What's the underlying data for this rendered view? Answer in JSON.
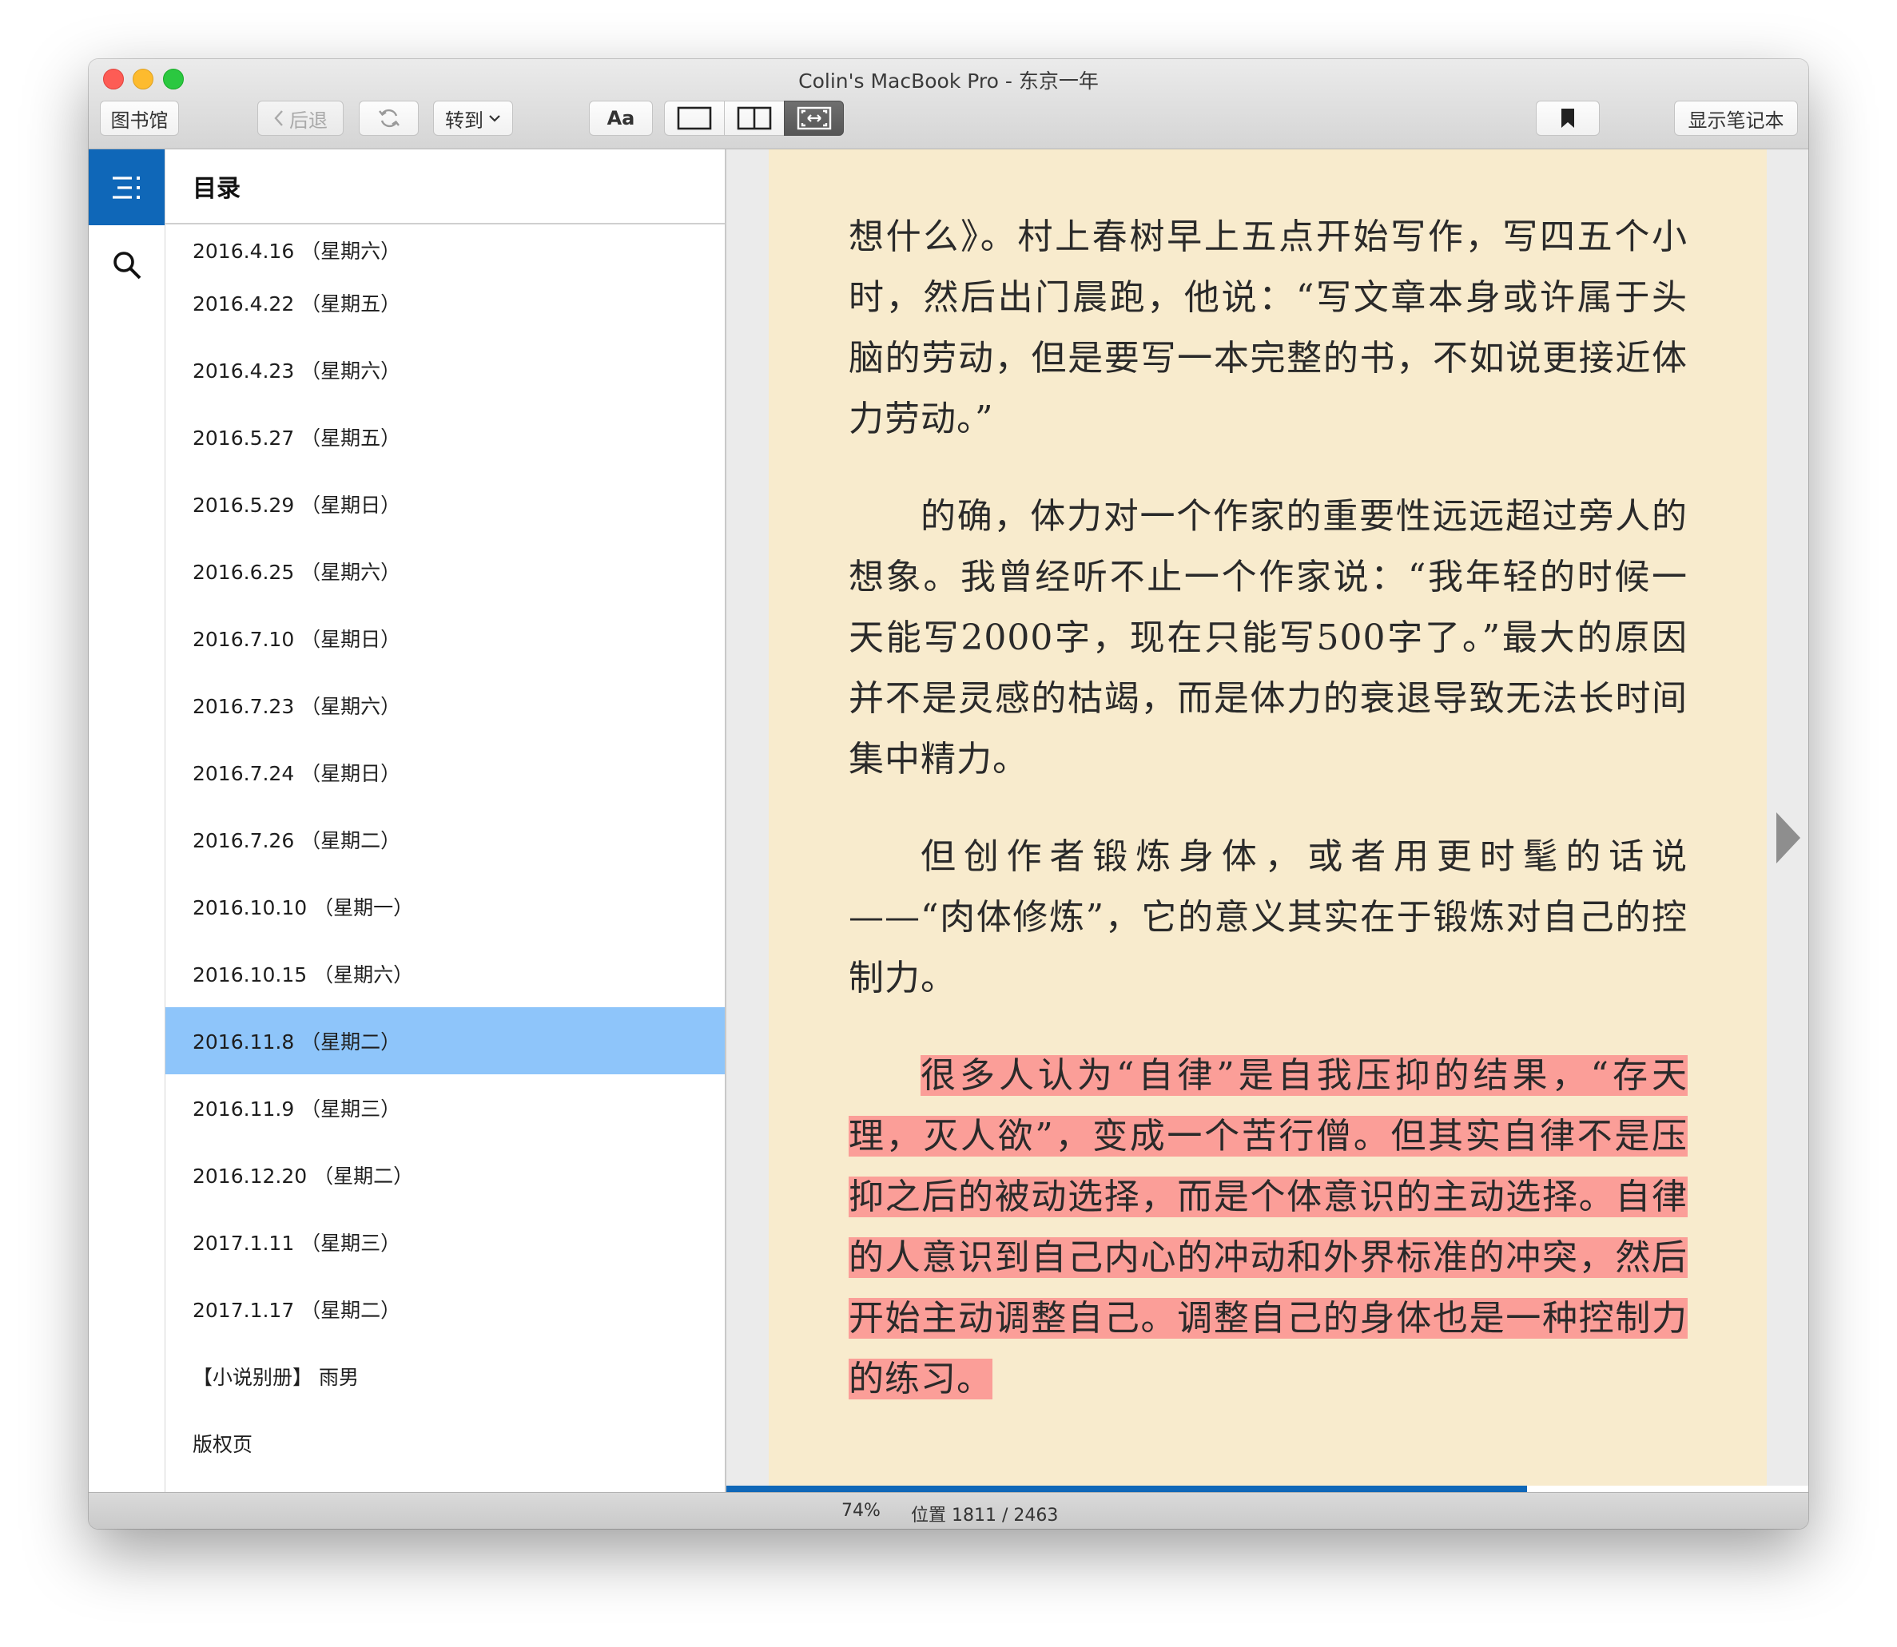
{
  "window": {
    "title": "Colin's MacBook Pro - 东京一年"
  },
  "toolbar": {
    "library_label": "图书馆",
    "back_label": "后退",
    "goto_label": "转到",
    "font_label": "Aa",
    "notebook_label": "显示笔记本",
    "view_modes": [
      "single-page-icon",
      "two-page-icon",
      "fit-width-icon"
    ],
    "active_view_mode": "fit-width-icon"
  },
  "sidebar": {
    "toc_title": "目录",
    "toc_items": [
      "2016.4.16 （星期六）",
      "2016.4.22 （星期五）",
      "2016.4.23 （星期六）",
      "2016.5.27 （星期五）",
      "2016.5.29 （星期日）",
      "2016.6.25 （星期六）",
      "2016.7.10 （星期日）",
      "2016.7.23 （星期六）",
      "2016.7.24 （星期日）",
      "2016.7.26 （星期二）",
      "2016.10.10 （星期一）",
      "2016.10.15 （星期六）",
      "2016.11.8 （星期二）",
      "2016.11.9 （星期三）",
      "2016.12.20 （星期二）",
      "2017.1.11 （星期三）",
      "2017.1.17 （星期二）",
      "【小说别册】 雨男",
      "版权页"
    ],
    "selected_index": 12
  },
  "reader": {
    "paragraphs": [
      "想什么》。村上春树早上五点开始写作，写四五个小时，然后出门晨跑，他说：“写文章本身或许属于头脑的劳动，但是要写一本完整的书，不如说更接近体力劳动。”",
      "的确，体力对一个作家的重要性远远超过旁人的想象。我曾经听不止一个作家说：“我年轻的时候一天能写2000字，现在只能写500字了。”最大的原因并不是灵感的枯竭，而是体力的衰退导致无法长时间集中精力。",
      "但创作者锻炼身体，或者用更时髦的话说——“肉体修炼”，它的意义其实在于锻炼对自己的控制力。",
      "很多人认为“自律”是自我压抑的结果，“存天理，灭人欲”，变成一个苦行僧。但其实自律不是压抑之后的被动选择，而是个体意识的主动选择。自律的人意识到自己内心的冲动和外界标准的冲突，然后开始主动调整自己。调整自己的身体也是一种控制力的练习。"
    ],
    "highlighted_paragraph": 3,
    "highlight_color": "#fb9e98",
    "page_color": "#f8ebcd"
  },
  "status": {
    "percent": "74%",
    "location": "位置 1811 / 2463",
    "progress_fraction": 0.74
  },
  "colors": {
    "accent": "#0f67b8",
    "selection": "#8ec5fa"
  }
}
